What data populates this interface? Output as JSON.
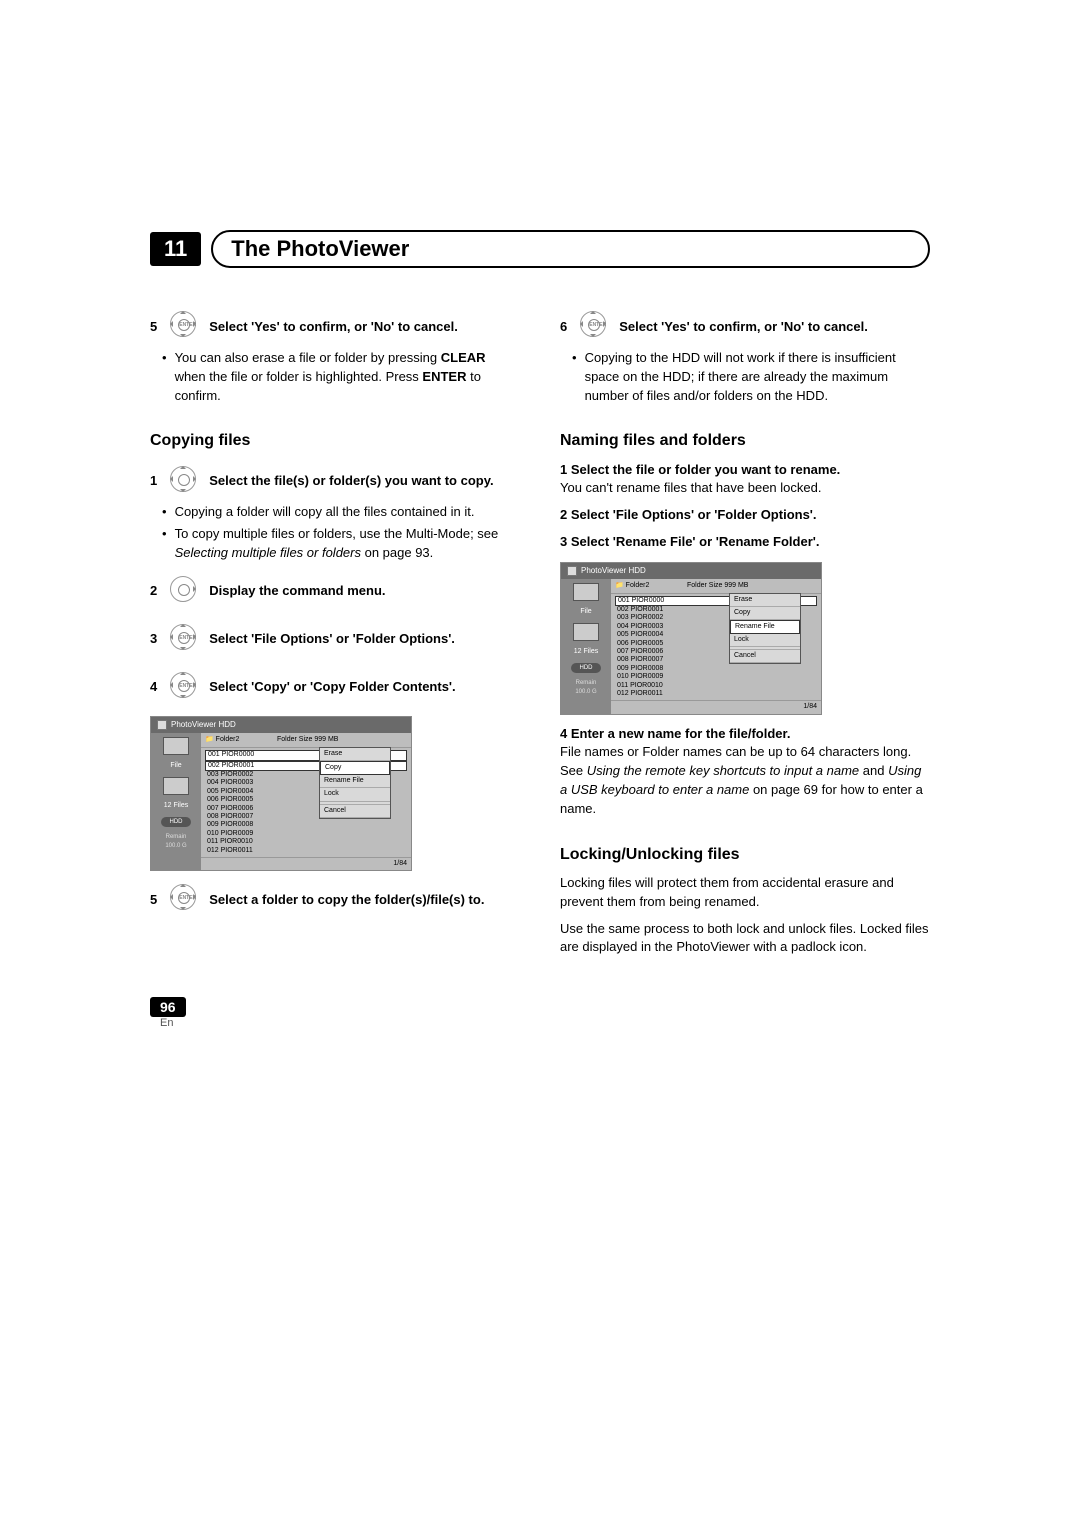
{
  "chapter": {
    "number": "11",
    "title": "The PhotoViewer"
  },
  "left": {
    "step5": {
      "num": "5",
      "text_a": "Select 'Yes' to confirm, or 'No' to cancel.",
      "bullet_a": "You can also erase a file or folder by pressing ",
      "bullet_b": "CLEAR",
      "bullet_c": " when the file or folder is highlighted. Press ",
      "bullet_d": "ENTER",
      "bullet_e": " to confirm."
    },
    "copying_heading": "Copying files",
    "copy1": {
      "num": "1",
      "text": "Select the file(s) or folder(s) you want to copy."
    },
    "copy1_b1": "Copying a folder will copy all the files contained in it.",
    "copy1_b2a": "To copy multiple files or folders, use the Multi-Mode; see ",
    "copy1_b2b": "Selecting multiple files or folders",
    "copy1_b2c": " on page 93.",
    "copy2": {
      "num": "2",
      "text": "Display the command menu."
    },
    "copy3": {
      "num": "3",
      "text": "Select 'File Options' or 'Folder Options'."
    },
    "copy4": {
      "num": "4",
      "text": "Select 'Copy' or 'Copy Folder Contents'."
    },
    "copy5": {
      "num": "5",
      "text": "Select a folder to copy the folder(s)/file(s) to."
    }
  },
  "right": {
    "step6": {
      "num": "6",
      "text": "Select 'Yes' to confirm, or 'No' to cancel."
    },
    "step6_bullet": "Copying to the HDD will not work if there is insufficient space on the HDD; if there are already the maximum number of files and/or folders on the HDD.",
    "naming_heading": "Naming files and folders",
    "name1": "1    Select the file or folder you want to rename.",
    "name1_body": "You can't rename files that have been locked.",
    "name2": "2    Select 'File Options' or 'Folder Options'.",
    "name3": "3    Select 'Rename File' or 'Rename Folder'.",
    "name4": "4    Enter a new name for the file/folder.",
    "name4_body": "File names or Folder names can be up to 64 characters long.",
    "name4_see_a": "See ",
    "name4_see_b": "Using the remote key shortcuts to input a name",
    "name4_see_c": " and ",
    "name4_see_d": "Using a USB keyboard to enter a name",
    "name4_see_e": " on page 69 for how to enter a name.",
    "locking_heading": "Locking/Unlocking files",
    "locking_p1": "Locking files will protect them from accidental erasure and prevent them from being renamed.",
    "locking_p2": "Use the same process to both lock and unlock files. Locked files are displayed in the PhotoViewer with a padlock icon."
  },
  "screenshot": {
    "title": "PhotoViewer  HDD",
    "folder": "Folder2",
    "size": "Folder Size 999 MB",
    "side": {
      "file": "File",
      "files": "12 Files",
      "hdd": "HDD",
      "remain": "Remain",
      "remain_val": "100.0 G"
    },
    "rows": [
      "001  PIOR0000",
      "002  PIOR0001",
      "003  PIOR0002",
      "004  PIOR0003",
      "005  PIOR0004",
      "006  PIOR0005",
      "007  PIOR0006",
      "008  PIOR0007",
      "009  PIOR0008",
      "010  PIOR0009",
      "011  PIOR0010",
      "012  PIOR0011"
    ],
    "menu1": {
      "sel_index": 1,
      "items": [
        "Erase",
        "Copy",
        "Rename File",
        "Lock",
        "",
        "Cancel"
      ]
    },
    "menu2": {
      "sel_index": 2,
      "items": [
        "Erase",
        "Copy",
        "Rename File",
        "Lock",
        "",
        "Cancel"
      ]
    },
    "counter": "1/84"
  },
  "footer": {
    "page": "96",
    "lang": "En"
  }
}
